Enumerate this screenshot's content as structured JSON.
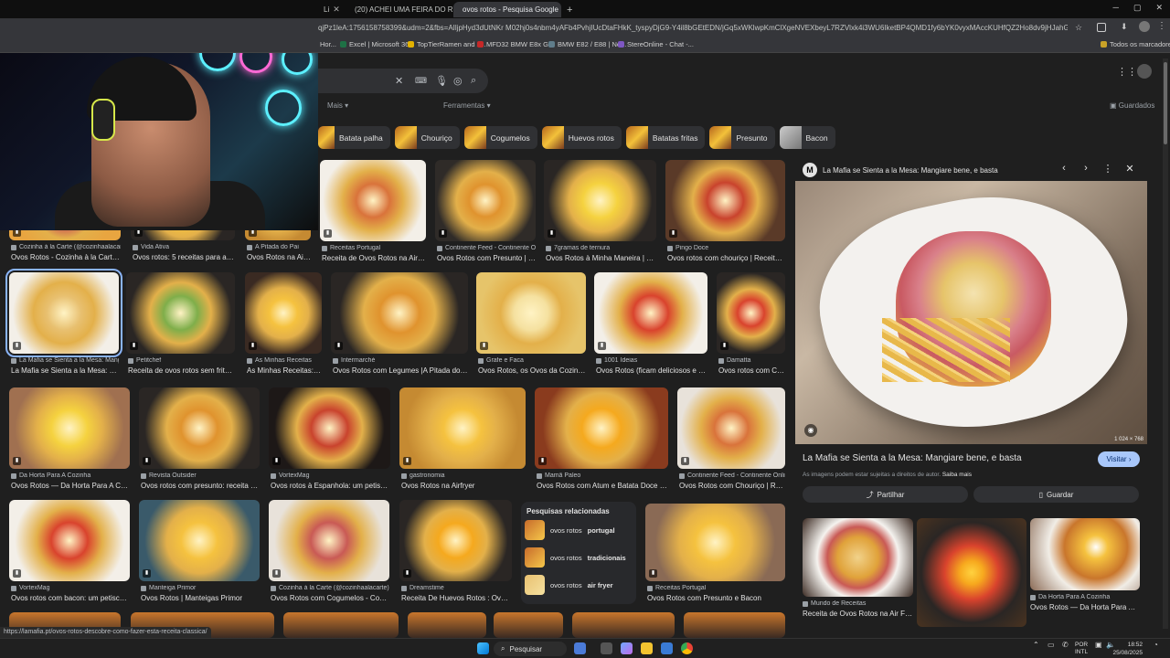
{
  "browser": {
    "tabs": [
      {
        "label": "Li",
        "active": false
      },
      {
        "label": "(20) ACHEI UMA FEIRA DO RO",
        "active": false
      },
      {
        "label": "ovos rotos - Pesquisa Google",
        "active": true
      }
    ],
    "url": "qjPz1leA:1756158758399&udm=2&fbs=AIljpHyd3dUtNKr M02hj0s4nbm4yAFb4PvhjIUcDtaFHkK_tyspyDjG9-Y4il8bGEtEDN/jGq5xWKlwpKmClXgeNVEXbeyL7RZVlxk4i3WU6IketBP4QMD1fy6bYK0vyxMAccKUHfQZ2Ho8dv9jHJahGOUVtzqdjD_t3w68OIie2AzaL5WAUgESd...",
    "bookmarks": [
      "Hor...",
      "Excel | Microsoft 365",
      "TopTierRamen and s...",
      "MFD32 BMW E8x G...",
      "BMW E82 / E88 | No...",
      "StereOnline - Chat -..."
    ],
    "all_bookmarks": "Todos os marcadores"
  },
  "search": {
    "more_label": "Mais",
    "tools_label": "Ferramentas",
    "saved_label": "Guardados",
    "chips": [
      "Batata palha",
      "Chouriço",
      "Cogumelos",
      "Huevos rotos",
      "Batatas fritas",
      "Presunto",
      "Bacon"
    ]
  },
  "results": [
    {
      "source": "Cozinha à la Carte (@cozinhaalacarte)",
      "title": "Ovos Rotos - Cozinha à la Carte (..."
    },
    {
      "source": "Vida Ativa",
      "title": "Ovos rotos: 5 receitas para alm..."
    },
    {
      "source": "A Pitada do Pai",
      "title": "Ovos Rotos na Air ..."
    },
    {
      "source": "Receitas Portugal",
      "title": "Receita de Ovos Rotos na Air fry..."
    },
    {
      "source": "Continente Feed - Continente O...",
      "title": "Ovos Rotos com Presunto | R..."
    },
    {
      "source": "7gramas de ternura",
      "title": "Ovos Rotos à Minha Maneira | 7gr..."
    },
    {
      "source": "Pingo Doce",
      "title": "Ovos rotos com chouriço | Receitas | ..."
    },
    {
      "source": "La Mafia se Sienta a la Mesa: Mangia...",
      "title": "La Mafia se Sienta a la Mesa: Ma..."
    },
    {
      "source": "Petitchef",
      "title": "Receita de ovos rotos sem fritura..."
    },
    {
      "source": "As Minhas Receitas",
      "title": "As Minhas Receitas: O..."
    },
    {
      "source": "Intermarché",
      "title": "Ovos Rotos com Legumes |A Pitada do Pai"
    },
    {
      "source": "Grafe e Faca",
      "title": "Ovos Rotos, os Ovos da Cozinha..."
    },
    {
      "source": "1001 Ideias",
      "title": "Ovos Rotos (ficam deliciosos e faz..."
    },
    {
      "source": "Damatta",
      "title": "Ovos rotos com Ch..."
    },
    {
      "source": "Da Horta Para A Cozinha",
      "title": "Ovos Rotos — Da Horta Para A Cozi..."
    },
    {
      "source": "Revista Outsider",
      "title": "Ovos rotos com presunto: receita trad..."
    },
    {
      "source": "VortexMag",
      "title": "Ovos rotos à Espanhola: um petisco ..."
    },
    {
      "source": "gastronomia",
      "title": "Ovos Rotos na Airfryer"
    },
    {
      "source": "Mamã Paleo",
      "title": "Ovos Rotos com Atum e Batata Doce - S..."
    },
    {
      "source": "Continente Feed - Continente Online",
      "title": "Ovos Rotos com Chouriço | Rece..."
    },
    {
      "source": "VortexMag",
      "title": "Ovos rotos com bacon: um petisco ..."
    },
    {
      "source": "Manteiga Primor",
      "title": "Ovos Rotos | Manteigas Primor"
    },
    {
      "source": "Cozinha à la Carte (@cozinhaalacarte)",
      "title": "Ovos Rotos com Cogumelos - Cozinh..."
    },
    {
      "source": "Dreamstime",
      "title": "Receita De Huevos Rotos : Ovos ..."
    },
    {
      "source": "Receitas Portugal",
      "title": "Ovos Rotos com Presunto e Bacon"
    }
  ],
  "related": {
    "heading": "Pesquisas relacionadas",
    "items": [
      {
        "prefix": "ovos rotos",
        "bold": "portugal"
      },
      {
        "prefix": "ovos rotos",
        "bold": "tradicionais"
      },
      {
        "prefix": "ovos rotos",
        "bold": "air fryer"
      }
    ]
  },
  "panel": {
    "site": "La Mafia se Sienta a la Mesa: Mangiare bene, e basta",
    "logo_letter": "M",
    "dims": "1 024 × 768",
    "title": "La Mafia se Sienta a la Mesa: Mangiare bene, e basta",
    "visit_label": "Visitar",
    "copyright": "As imagens podem estar sujeitas a direitos de autor.",
    "copyright_link": "Saiba mais",
    "share_label": "Partilhar",
    "save_label": "Guardar",
    "similar": [
      {
        "source": "Mundo de Receitas",
        "title": "Receita de Ovos Rotos na Air Frye..."
      },
      {
        "source": "",
        "title": ""
      },
      {
        "source": "Da Horta Para A Cozinha",
        "title": "Ovos Rotos — Da Horta Para A Co..."
      }
    ]
  },
  "status_url": "https://lamafia.pt/ovos-rotos-descobre-como-fazer-esta-receita-classica/",
  "taskbar": {
    "search_label": "Pesquisar",
    "lang": "POR",
    "layout": "INTL",
    "time": "18:52",
    "date": "25/08/2025"
  },
  "colors": {
    "accent": "#8ab4f8",
    "visit_button": "#a8c7fa",
    "background": "#1f1f1f"
  }
}
